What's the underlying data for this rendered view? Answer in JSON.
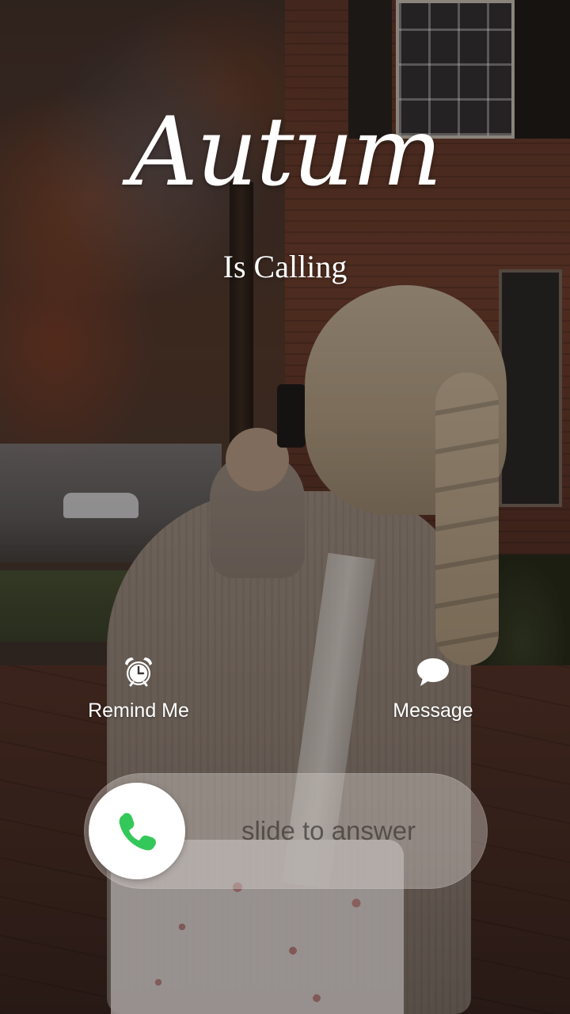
{
  "caller": {
    "name": "Autum",
    "status": "Is Calling"
  },
  "actions": {
    "remind": {
      "label": "Remind Me",
      "icon": "alarm-clock-icon"
    },
    "message": {
      "label": "Message",
      "icon": "speech-bubble-icon"
    }
  },
  "slider": {
    "label": "slide to answer",
    "knob_icon": "phone-icon",
    "accent_color": "#34c759"
  }
}
